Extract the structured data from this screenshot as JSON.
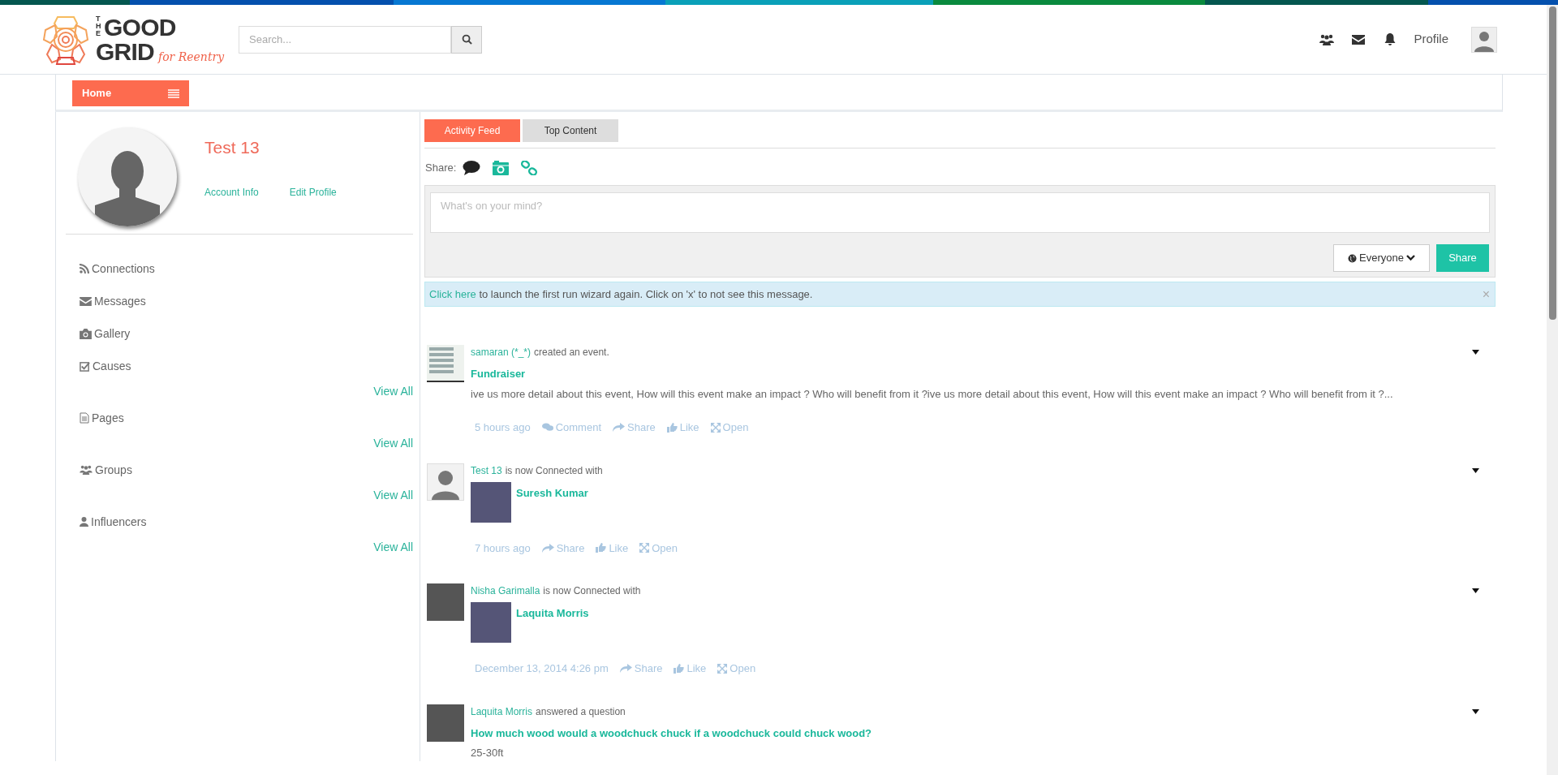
{
  "header": {
    "logo": {
      "line_1": "THE",
      "line_2": "GOOD",
      "line_3": "GRID",
      "tagline": "for Reentry"
    },
    "search": {
      "placeholder": "Search..."
    },
    "profile_label": "Profile"
  },
  "nav": {
    "home": "Home"
  },
  "profile": {
    "name": "Test 13",
    "links": [
      "Account Info",
      "Edit Profile"
    ]
  },
  "sidebar": {
    "items": [
      {
        "label": "Connections"
      },
      {
        "label": "Messages"
      },
      {
        "label": "Gallery"
      },
      {
        "label": "Causes",
        "view_all": "View All"
      },
      {
        "label": "Pages",
        "view_all": "View All"
      },
      {
        "label": "Groups",
        "view_all": "View All"
      },
      {
        "label": "Influencers",
        "view_all": "View All"
      }
    ]
  },
  "feed": {
    "tabs": [
      {
        "label": "Activity Feed",
        "selected": true
      },
      {
        "label": "Top Content",
        "selected": false
      }
    ],
    "share_label": "Share:",
    "share_options": [
      {
        "selected": true
      },
      {
        "selected": false
      },
      {
        "selected": false
      }
    ],
    "composer": {
      "placeholder": "What's on your mind?"
    },
    "audience": "Everyone",
    "share_button": "Share",
    "notice": {
      "link": "Click here",
      "text": "to launch the first run wizard again. Click on 'x' to not see this message.",
      "close": "×"
    },
    "posts": [
      {
        "kind": "screenshot",
        "actor": "samaran (*_*)",
        "action": "created an event.",
        "title": "Fundraiser",
        "body": "ive us more detail about this event, How will this event make an impact ? Who will benefit from it ?ive us more detail about this event, How will this event make an impact ? Who will benefit from it ?...",
        "time": "5 hours ago",
        "actions": [
          {
            "kind": "comment",
            "label": "Comment"
          },
          {
            "kind": "share",
            "label": "Share"
          },
          {
            "kind": "like",
            "label": "Like"
          },
          {
            "kind": "open",
            "label": "Open"
          }
        ]
      },
      {
        "kind": "silhouette",
        "actor": "Test 13",
        "action": "is now Connected with",
        "target": "Suresh Kumar",
        "time": "7 hours ago",
        "actions": [
          {
            "kind": "share",
            "label": "Share"
          },
          {
            "kind": "like",
            "label": "Like"
          },
          {
            "kind": "open",
            "label": "Open"
          }
        ]
      },
      {
        "kind": "photo",
        "actor": "Nisha Garimalla",
        "action": "is now Connected with",
        "target": "Laquita Morris",
        "time": "December 13, 2014 4:26 pm",
        "actions": [
          {
            "kind": "share",
            "label": "Share"
          },
          {
            "kind": "like",
            "label": "Like"
          },
          {
            "kind": "open",
            "label": "Open"
          }
        ]
      },
      {
        "kind": "photo",
        "actor": "Laquita Morris",
        "action": "answered a question",
        "title": "How much wood would a woodchuck chuck if a woodchuck could chuck wood?",
        "body": "25-30ft"
      }
    ]
  }
}
